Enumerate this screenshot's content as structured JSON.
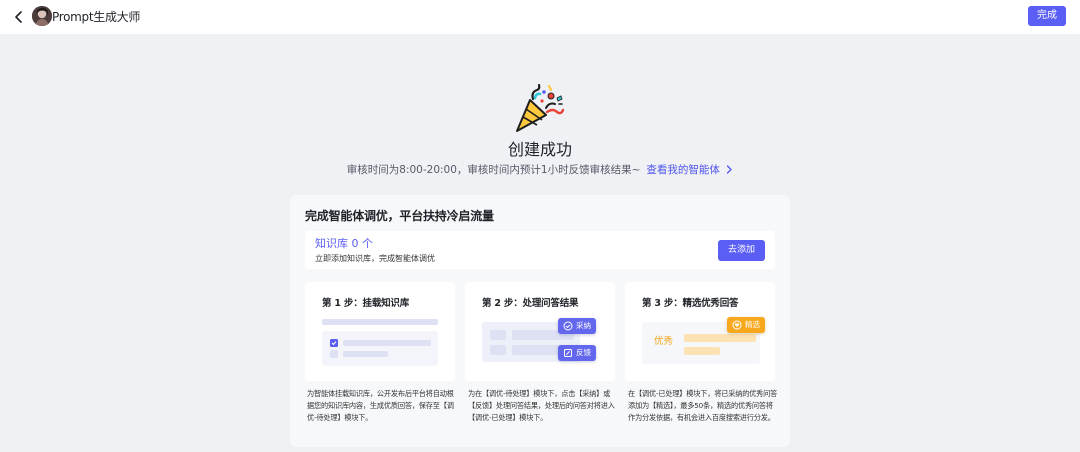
{
  "header": {
    "back_icon": "chevron-left-icon",
    "avatar_icon": "user-avatar",
    "title": "Prompt生成大师",
    "done_label": "完成",
    "accent_color": "#5b5ef5"
  },
  "success": {
    "icon": "party-popper-icon",
    "title": "创建成功",
    "review_text": "审核时间为8:00-20:00，审核时间内预计1小时反馈审核结果~",
    "link_label": "查看我的智能体",
    "link_icon": "chevron-right-icon"
  },
  "panel": {
    "title": "完成智能体调优，平台扶持冷启流量",
    "knowledge_base": {
      "title": "知识库 0 个",
      "desc": "立即添加知识库，完成智能体调优",
      "add_label": "去添加"
    },
    "steps": [
      {
        "title": "第 1 步：挂载知识库",
        "desc": "为智能体挂载知识库，公开发布后平台将自动根据您的知识库内容，生成优质回答，保存至【调优-待处理】模块下。"
      },
      {
        "title": "第 2 步：处理问答结果",
        "desc": "为在【调优-待处理】模块下，点击【采纳】或【反馈】处理问答结果，处理后的问答对将进入【调优-已处理】模块下。",
        "adopt_label": "采纳",
        "feedback_label": "反馈"
      },
      {
        "title": "第 3 步：精选优秀回答",
        "desc": "在【调优-已处理】模块下，将已采纳的优秀问答添加为【精选】，最多50条，精选的优秀问答将作为分发依据，有机会进入百度搜索进行分发。",
        "good_label": "优秀",
        "featured_label": "精选"
      }
    ]
  }
}
